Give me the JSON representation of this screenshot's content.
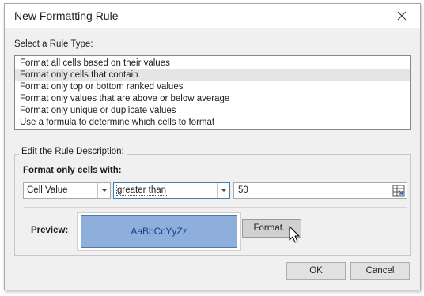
{
  "dialog": {
    "title": "New Formatting Rule",
    "close_glyph": "✕"
  },
  "rule_type": {
    "label": "Select a Rule Type:",
    "items": [
      "Format all cells based on their values",
      "Format only cells that contain",
      "Format only top or bottom ranked values",
      "Format only values that are above or below average",
      "Format only unique or duplicate values",
      "Use a formula to determine which cells to format"
    ],
    "selected_index": 1
  },
  "description": {
    "legend": "Edit the Rule Description:",
    "heading": "Format only cells with:",
    "condition_field": "Cell Value",
    "operator": "greater than",
    "value": "50"
  },
  "preview": {
    "label": "Preview:",
    "sample_text": "AaBbCcYyZz",
    "fill_color": "#8eaedb",
    "text_color": "#1d3f8a"
  },
  "buttons": {
    "format": "Format...",
    "ok": "OK",
    "cancel": "Cancel"
  },
  "icons": {
    "close": "close-icon",
    "dropdown": "chevron-down-icon",
    "cell_reference": "cell-reference-icon",
    "cursor": "mouse-pointer-icon"
  }
}
